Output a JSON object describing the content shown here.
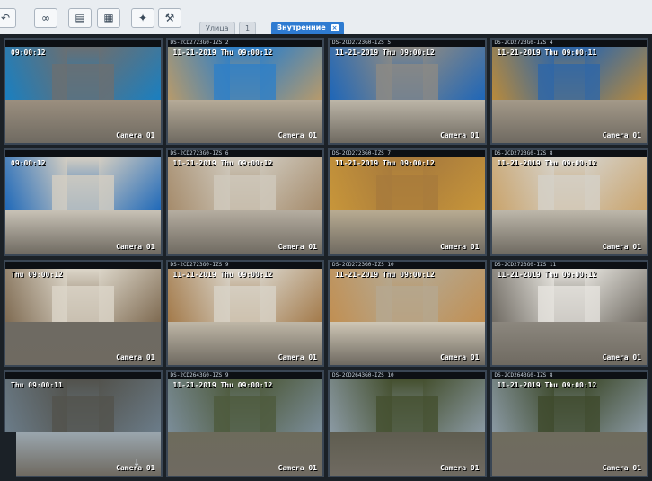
{
  "toolbar": {
    "icons": [
      "back-icon",
      "loop-icon",
      "chat-icon",
      "layout-icon",
      "magic-wand-icon",
      "tools-icon"
    ],
    "tabs": [
      {
        "label": "Улица",
        "active": false
      },
      {
        "label": "1",
        "active": false
      },
      {
        "label": "Внутренние",
        "active": true
      }
    ]
  },
  "cameras": [
    {
      "title": "",
      "time": "09:00:12",
      "cam": "Camera 01",
      "palette": [
        "#1a7fc0",
        "#6a6f72",
        "#9b8f7f"
      ]
    },
    {
      "title": "DS-2CD2723G0-IZS 2",
      "time": "11-21-2019 Thu 09:00:12",
      "cam": "Camera 01",
      "palette": [
        "#b79a6b",
        "#2f7fc7",
        "#b6ab98"
      ]
    },
    {
      "title": "DS-2CD2723G0-IZS 5",
      "time": "11-21-2019 Thu 09:00:12",
      "cam": "Camera 01",
      "palette": [
        "#1e66b8",
        "#8c8a84",
        "#bdb6a8"
      ]
    },
    {
      "title": "DS-2CD2723G0-IZS 4",
      "time": "11-21-2019 Thu 09:00:11",
      "cam": "Camera 01",
      "palette": [
        "#b98a3b",
        "#2e66a8",
        "#a49a89"
      ]
    },
    {
      "title": "",
      "time": "09:00:12",
      "cam": "Camera 01",
      "palette": [
        "#1f69b9",
        "#d4cec2",
        "#c8c2b6"
      ]
    },
    {
      "title": "DS-2CD2723G0-IZS 6",
      "time": "11-21-2019 Thu 09:00:12",
      "cam": "Camera 01",
      "palette": [
        "#a58b6b",
        "#cfc9bd",
        "#b5ada0"
      ]
    },
    {
      "title": "DS-2CD2723G0-IZS 7",
      "time": "11-21-2019 Thu 09:00:12",
      "cam": "Camera 01",
      "palette": [
        "#c8963a",
        "#a77a3c",
        "#b8ab92"
      ]
    },
    {
      "title": "DS-2CD2723G0-IZS 8",
      "time": "11-21-2019 Thu 09:00:12",
      "cam": "Camera 01",
      "palette": [
        "#c9a36b",
        "#d5d1c8",
        "#bdb7aa"
      ]
    },
    {
      "title": "",
      "time": "Thu 09:00:12",
      "cam": "Camera 01",
      "palette": [
        "#7f6b52",
        "#dcd6c9",
        "#6e6a62"
      ]
    },
    {
      "title": "DS-2CD2723G0-IZS 9",
      "time": "11-21-2019 Thu 09:00:12",
      "cam": "Camera 01",
      "palette": [
        "#a37a4a",
        "#d8d3c8",
        "#bfb7a7"
      ]
    },
    {
      "title": "DS-2CD2723G0-IZS 10",
      "time": "11-21-2019 Thu 09:00:12",
      "cam": "Camera 01",
      "palette": [
        "#c18f52",
        "#b5a890",
        "#cfc7b6"
      ]
    },
    {
      "title": "DS-2CD2723G0-IZS 11",
      "time": "11-21-2019 Thu 09:00:12",
      "cam": "Camera 01",
      "palette": [
        "#6f6a62",
        "#e6e4de",
        "#8c877e"
      ]
    },
    {
      "title": "",
      "time": "Thu 09:00:11",
      "cam": "Camera 01",
      "palette": [
        "#6b7c89",
        "#52524c",
        "#9aa6ae"
      ]
    },
    {
      "title": "DS-2CD2643G0-IZS 9",
      "time": "11-21-2019 Thu 09:00:12",
      "cam": "Camera 01",
      "palette": [
        "#7b8d99",
        "#4e5a3c",
        "#6d6b5c"
      ]
    },
    {
      "title": "DS-2CD2643G0-IZS 10",
      "time": "",
      "cam": "Camera 01",
      "palette": [
        "#8b9aa4",
        "#45502f",
        "#5f5d50"
      ]
    },
    {
      "title": "DS-2CD2643G0-IZS 8",
      "time": "11-21-2019 Thu 09:00:12",
      "cam": "Camera 01",
      "palette": [
        "#8a99a3",
        "#3e4a2c",
        "#6f6c5e"
      ]
    }
  ]
}
